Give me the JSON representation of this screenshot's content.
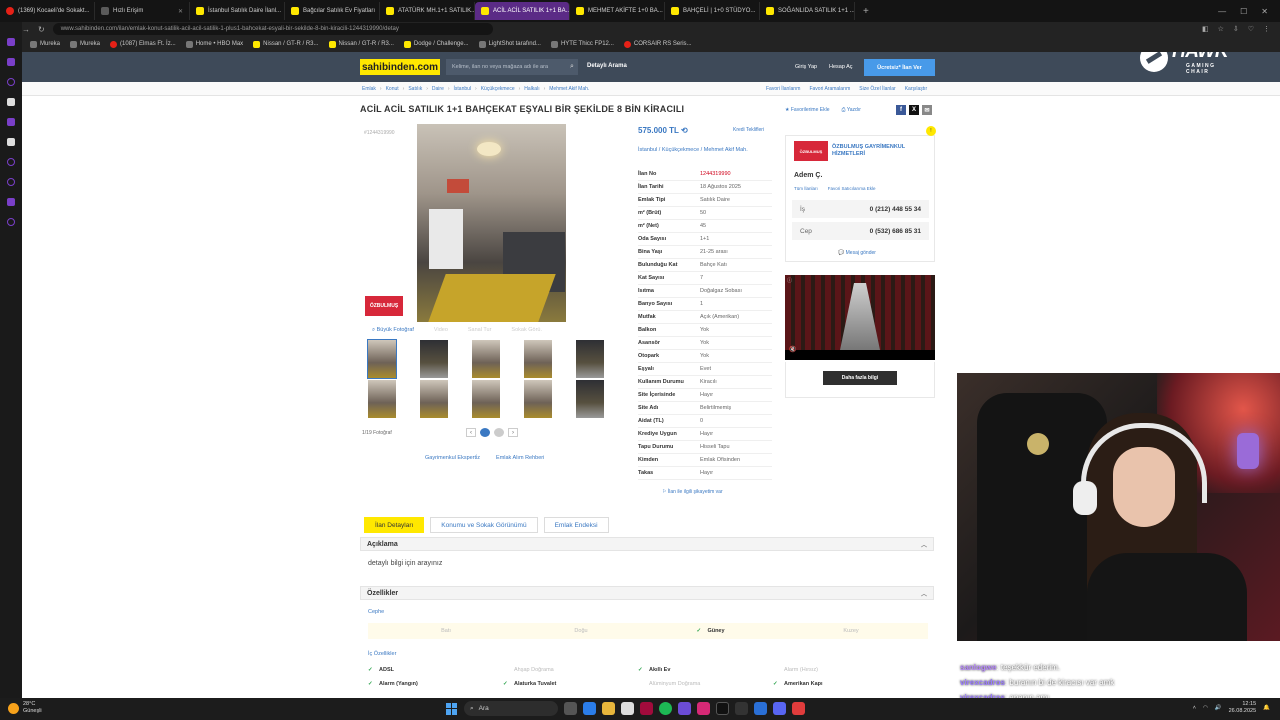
{
  "browser": {
    "tabs": [
      {
        "label": "(1369) Kocaeli'de Sokakt...",
        "icon": "youtube",
        "active": false
      },
      {
        "label": "Hızlı Erişim",
        "icon": "speed-dial",
        "active": false
      },
      {
        "label": "İstanbul Satılık Daire İlanl...",
        "icon": "sahibinden",
        "active": false
      },
      {
        "label": "Bağcılar Satılık Ev Fiyatları",
        "icon": "sahibinden",
        "active": false
      },
      {
        "label": "ATATÜRK MH.1+1 SATILIK...",
        "icon": "sahibinden",
        "active": false
      },
      {
        "label": "ACİL ACİL SATILIK 1+1 BA...",
        "icon": "sahibinden",
        "active": true
      },
      {
        "label": "MEHMET AKİFTE 1+0 BA...",
        "icon": "sahibinden",
        "active": false
      },
      {
        "label": "BAHÇELİ | 1+0 STÜDYO...",
        "icon": "sahibinden",
        "active": false
      },
      {
        "label": "SOĞANLIDA SATILIK 1+1 ...",
        "icon": "sahibinden",
        "active": false
      }
    ],
    "url": "www.sahibinden.com/ilan/emlak-konut-satilik-acil-acil-satilik-1-plus1-bahcekat-esyali-bir-sekilde-8-bin-kiracili-1244319990/detay",
    "bookmarks": [
      {
        "label": "Mureka",
        "icon": "mono"
      },
      {
        "label": "Mureka",
        "icon": "mono"
      },
      {
        "label": "(1087) Elmas Ft. İz...",
        "icon": "red"
      },
      {
        "label": "Home • HBO Max",
        "icon": "mono"
      },
      {
        "label": "Nissan / GT-R / R3...",
        "icon": "yellow"
      },
      {
        "label": "Nissan / GT-R / R3...",
        "icon": "yellow"
      },
      {
        "label": "Dodge / Challenge...",
        "icon": "yellow"
      },
      {
        "label": "LightShot tarafınd...",
        "icon": "mono"
      },
      {
        "label": "HYTE Thicc FP12...",
        "icon": "mono"
      },
      {
        "label": "CORSAIR RS Seris...",
        "icon": "red"
      }
    ]
  },
  "site": {
    "logo": "sahibinden.com",
    "search_placeholder": "Kelime, ilan no veya mağaza adı ile ara",
    "advanced_search": "Detaylı Arama",
    "login": "Giriş Yap",
    "register": "Hesap Aç",
    "post_button": "Ücretsiz* İlan Ver",
    "breadcrumb": [
      "Emlak",
      "Konut",
      "Satılık",
      "Daire",
      "İstanbul",
      "Küçükçekmece",
      "Halkalı",
      "Mehmet Akif Mah."
    ],
    "sublinks": [
      "Favori İlanlarım",
      "Favori Aramalarım",
      "Size Özel İlanlar",
      "Karşılaştır"
    ],
    "title": "ACİL ACİL SATILIK 1+1 BAHÇEKAT EŞYALI BİR ŞEKİLDE 8 BİN KİRACILI",
    "favorite": "Favorilerime Ekle",
    "print": "Yazdır",
    "listing_no_small": "#1244319990",
    "agency_logo_text": "ÖZBULMUŞ",
    "photo_tools": {
      "big": "Büyük Fotoğraf",
      "video": "Video",
      "virtual_tour": "Sanal Tur",
      "map": "Sokak Görü."
    },
    "photo_count": "1/19 Fotoğraf",
    "bottom_links": [
      "Gayrimenkul Eksperti̇z",
      "Emlak Alım Rehberi"
    ],
    "price": "575.000 TL",
    "credit_offers": "Kredi Teklifleri",
    "location": [
      "İstanbul",
      "Küçükçekmece",
      "Mehmet Akif Mah."
    ],
    "specs": [
      {
        "k": "İlan No",
        "v": "1244319990",
        "red": true
      },
      {
        "k": "İlan Tarihi",
        "v": "18 Ağustos 2025"
      },
      {
        "k": "Emlak Tipi",
        "v": "Satılık Daire"
      },
      {
        "k": "m² (Brüt)",
        "v": "50"
      },
      {
        "k": "m² (Net)",
        "v": "45"
      },
      {
        "k": "Oda Sayısı",
        "v": "1+1"
      },
      {
        "k": "Bina Yaşı",
        "v": "21-25 arası"
      },
      {
        "k": "Bulunduğu Kat",
        "v": "Bahçe Katı"
      },
      {
        "k": "Kat Sayısı",
        "v": "7"
      },
      {
        "k": "Isıtma",
        "v": "Doğalgaz Sobası"
      },
      {
        "k": "Banyo Sayısı",
        "v": "1"
      },
      {
        "k": "Mutfak",
        "v": "Açık (Amerikan)"
      },
      {
        "k": "Balkon",
        "v": "Yok"
      },
      {
        "k": "Asansör",
        "v": "Yok"
      },
      {
        "k": "Otopark",
        "v": "Yok"
      },
      {
        "k": "Eşyalı",
        "v": "Evet"
      },
      {
        "k": "Kullanım Durumu",
        "v": "Kiracılı"
      },
      {
        "k": "Site İçerisinde",
        "v": "Hayır"
      },
      {
        "k": "Site Adı",
        "v": "Belirtilmemiş"
      },
      {
        "k": "Aidat (TL)",
        "v": "0"
      },
      {
        "k": "Krediye Uygun",
        "v": "Hayır"
      },
      {
        "k": "Tapu Durumu",
        "v": "Hisseli Tapu"
      },
      {
        "k": "Kimden",
        "v": "Emlak Ofisinden"
      },
      {
        "k": "Takas",
        "v": "Hayır"
      }
    ],
    "report": "İlan ile ilgili şikayetim var",
    "seller": {
      "logo_text": "ÖZBULMUŞ",
      "name": "ÖZBULMUŞ GAYRİMENKUL HİZMETLERİ",
      "person": "Adem Ç.",
      "all_listings": "Tüm İlanları",
      "fav_seller": "Favori Satıcılarıma Ekle",
      "phones": [
        {
          "k": "İş",
          "v": "0 (212) 448 55 34"
        },
        {
          "k": "Cep",
          "v": "0 (532) 686 85 31"
        }
      ],
      "message": "Mesaj gönder"
    },
    "ad_cta": "Daha fazla bilgi",
    "detail_tabs": [
      "İlan Detayları",
      "Konumu ve Sokak Görünümü",
      "Emlak Endeksi"
    ],
    "desc_title": "Açıklama",
    "desc_text": "detaylı bilgi için arayınız",
    "features_title": "Özellikler",
    "cephe_title": "Cephe",
    "cephe": [
      {
        "label": "Batı",
        "on": false
      },
      {
        "label": "Doğu",
        "on": false
      },
      {
        "label": "Güney",
        "on": true
      },
      {
        "label": "Kuzey",
        "on": false
      }
    ],
    "inner_title": "İç Özellikler",
    "inner_rows": [
      [
        {
          "label": "ADSL",
          "on": true
        },
        {
          "label": "Ahşap Doğrama",
          "on": false
        },
        {
          "label": "Akıllı Ev",
          "on": true
        },
        {
          "label": "Alarm (Hırsız)",
          "on": false
        }
      ],
      [
        {
          "label": "Alarm (Yangın)",
          "on": true
        },
        {
          "label": "Alaturka Tuvalet",
          "on": true
        },
        {
          "label": "Alüminyum Doğrama",
          "on": false
        },
        {
          "label": "Amerikan Kapı",
          "on": true
        }
      ]
    ]
  },
  "hawk": {
    "word": "HAWK",
    "sub": "GAMING CHAIR"
  },
  "chat": [
    {
      "user": "sanlogwe",
      "color": "#b786ff",
      "msg": ": teşekkür ederim."
    },
    {
      "user": "virexcadros",
      "color": "#9b7bff",
      "msg": ": buranın bi de kiracısı var amk"
    },
    {
      "user": "virexcadros",
      "color": "#9b7bff",
      "msg": ": ananın amı"
    },
    {
      "user": "falscheros",
      "color": "#ffffff",
      "msg": ": bence 200tane bot var yayında :D"
    }
  ],
  "taskbar": {
    "temp": "28°C",
    "weather": "Güneşli",
    "search": "Ara",
    "time": "12:15",
    "date": "26.08.2025"
  }
}
